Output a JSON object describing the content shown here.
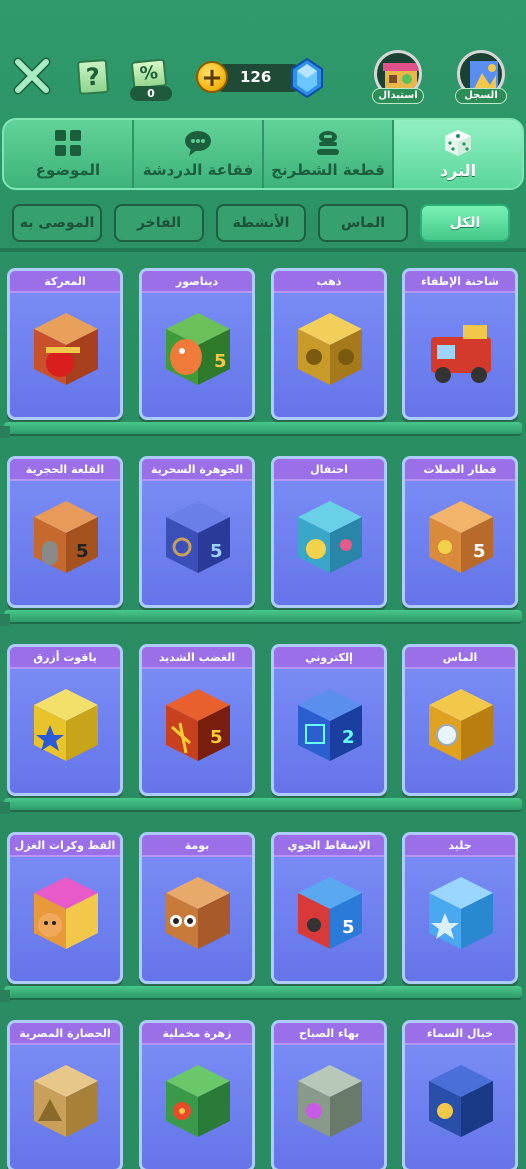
{
  "top_bar": {
    "coupon_count": "0",
    "gem_count": "126",
    "avatar_exchange_label": "استبدال",
    "avatar_record_label": "السجل",
    "help_glyph": "?",
    "coupon_glyph": "%"
  },
  "main_tabs": [
    {
      "label": "النرد",
      "icon": "dice-icon",
      "active": true
    },
    {
      "label": "قطعة الشطرنج",
      "icon": "chess-piece-icon",
      "active": false
    },
    {
      "label": "فقاعة الدردشة",
      "icon": "chat-bubble-icon",
      "active": false
    },
    {
      "label": "الموضوع",
      "icon": "theme-grid-icon",
      "active": false
    }
  ],
  "filters": [
    {
      "label": "الكل",
      "active": true
    },
    {
      "label": "الماس",
      "active": false
    },
    {
      "label": "الأنشطة",
      "active": false
    },
    {
      "label": "الفاخر",
      "active": false
    },
    {
      "label": "الموصى به",
      "active": false
    }
  ],
  "grid": {
    "rows": [
      [
        {
          "title": "شاحنة الإطفاء",
          "art": "fire-truck-dice-icon",
          "color": "#d33a2c"
        },
        {
          "title": "ذهب",
          "art": "gold-dice-icon",
          "color": "#c89a2a"
        },
        {
          "title": "ديناصور",
          "art": "dinosaur-dice-icon",
          "color": "#3f9a3a"
        },
        {
          "title": "المعركة",
          "art": "battle-dice-icon",
          "color": "#c8502a"
        }
      ],
      [
        {
          "title": "قطار العملات",
          "art": "coin-train-dice-icon",
          "color": "#d98a3a"
        },
        {
          "title": "احتفال",
          "art": "celebration-dice-icon",
          "color": "#3aa6c8"
        },
        {
          "title": "الجوهرة السحرية",
          "art": "magic-gem-dice-icon",
          "color": "#3a4fb8"
        },
        {
          "title": "القلعة الحجرية",
          "art": "stone-castle-dice-icon",
          "color": "#c6692f"
        }
      ],
      [
        {
          "title": "الماس",
          "art": "diamond-dice-icon",
          "color": "#e0a020"
        },
        {
          "title": "إلكتروني",
          "art": "electronic-dice-icon",
          "color": "#2b5fd0"
        },
        {
          "title": "الغضب الشديد",
          "art": "rage-dice-icon",
          "color": "#c8401e"
        },
        {
          "title": "ياقوت أزرق",
          "art": "sapphire-dice-icon",
          "color": "#e8c42a"
        }
      ],
      [
        {
          "title": "جليد",
          "art": "ice-dice-icon",
          "color": "#4aa8f0"
        },
        {
          "title": "الإسقاط الجوي",
          "art": "airdrop-dice-icon",
          "color": "#2a7bd8"
        },
        {
          "title": "بومة",
          "art": "owl-dice-icon",
          "color": "#c87a3a"
        },
        {
          "title": "القط وكرات الغزل",
          "art": "cat-yarn-dice-icon",
          "color": "#e89a3a"
        }
      ],
      [
        {
          "title": "خيال السماء",
          "art": "sky-fantasy-dice-icon",
          "color": "#2a4fa8"
        },
        {
          "title": "بهاء الصباح",
          "art": "morning-glory-dice-icon",
          "color": "#8a9a8a"
        },
        {
          "title": "زهرة مخملية",
          "art": "velvet-flower-dice-icon",
          "color": "#3a9a4a"
        },
        {
          "title": "الحضارة المصرية",
          "art": "egyptian-dice-icon",
          "color": "#c8a05a"
        }
      ]
    ]
  }
}
